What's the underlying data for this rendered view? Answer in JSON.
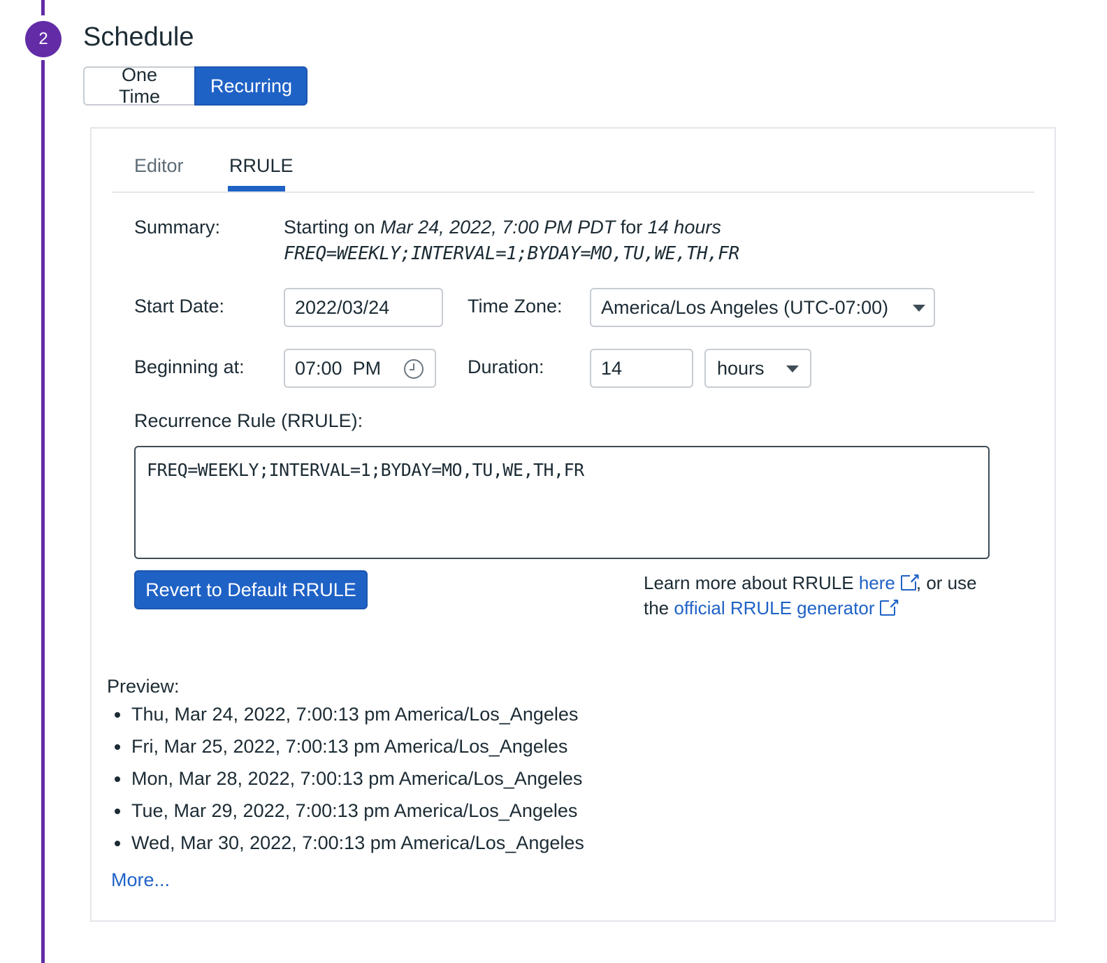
{
  "step": {
    "number": "2",
    "title": "Schedule"
  },
  "schedule_type": {
    "options": [
      "One Time",
      "Recurring"
    ],
    "selected": "Recurring"
  },
  "tabs": [
    {
      "label": "Editor"
    },
    {
      "label": "RRULE",
      "active": true
    }
  ],
  "summary": {
    "label": "Summary:",
    "prefix": "Starting on ",
    "start": "Mar 24, 2022, 7:00 PM PDT",
    "middle": " for ",
    "duration": "14 hours",
    "rule": "FREQ=WEEKLY;INTERVAL=1;BYDAY=MO,TU,WE,TH,FR"
  },
  "start_date": {
    "label": "Start Date:",
    "value": "2022/03/24"
  },
  "time_zone": {
    "label": "Time Zone:",
    "value": "America/Los Angeles (UTC-07:00)"
  },
  "beginning_at": {
    "label": "Beginning at:",
    "value": "07:00  PM"
  },
  "duration": {
    "label": "Duration:",
    "value": "14",
    "unit": "hours"
  },
  "rrule": {
    "label": "Recurrence Rule (RRULE):",
    "value": "FREQ=WEEKLY;INTERVAL=1;BYDAY=MO,TU,WE,TH,FR"
  },
  "revert_button": "Revert to Default RRULE",
  "learn_more": {
    "text1": "Learn more about RRULE ",
    "link1": "here",
    "text2": ", or use",
    "text3": "the ",
    "link2": "official RRULE generator"
  },
  "preview": {
    "label": "Preview:",
    "items": [
      "Thu, Mar 24, 2022, 7:00:13 pm America/Los_Angeles",
      "Fri, Mar 25, 2022, 7:00:13 pm America/Los_Angeles",
      "Mon, Mar 28, 2022, 7:00:13 pm America/Los_Angeles",
      "Tue, Mar 29, 2022, 7:00:13 pm America/Los_Angeles",
      "Wed, Mar 30, 2022, 7:00:13 pm America/Los_Angeles"
    ],
    "more": "More..."
  },
  "colors": {
    "accent": "#1f62c6",
    "step": "#632ca6",
    "border": "#c7ccd2"
  }
}
